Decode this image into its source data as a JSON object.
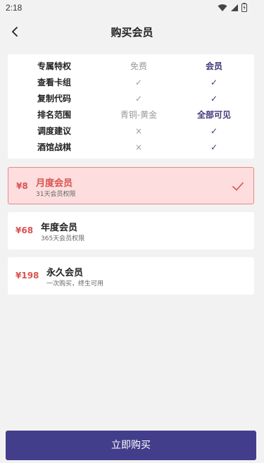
{
  "status_bar": {
    "time": "2:18"
  },
  "header": {
    "title": "购买会员"
  },
  "comparison": {
    "header": {
      "feature": "专属特权",
      "free": "免费",
      "member": "会员"
    },
    "rows": [
      {
        "feature": "查看卡组",
        "free": "✓",
        "member": "✓"
      },
      {
        "feature": "复制代码",
        "free": "✓",
        "member": "✓"
      },
      {
        "feature": "排名范围",
        "free": "青铜-黄金",
        "member": "全部可见"
      },
      {
        "feature": "调度建议",
        "free": "×",
        "member": "✓"
      },
      {
        "feature": "酒馆战棋",
        "free": "×",
        "member": "✓"
      }
    ]
  },
  "plans": [
    {
      "price": "¥8",
      "name": "月度会员",
      "desc": "31天会员权限",
      "selected": true
    },
    {
      "price": "¥68",
      "name": "年度会员",
      "desc": "365天会员权限",
      "selected": false
    },
    {
      "price": "¥198",
      "name": "永久会员",
      "desc": "一次购买，终生可用",
      "selected": false
    }
  ],
  "buy_button": {
    "label": "立即购买"
  },
  "colors": {
    "primary": "#433e8b",
    "accent_red": "#d9534f",
    "selected_bg": "#fdddde",
    "background": "#f2f2f2"
  }
}
